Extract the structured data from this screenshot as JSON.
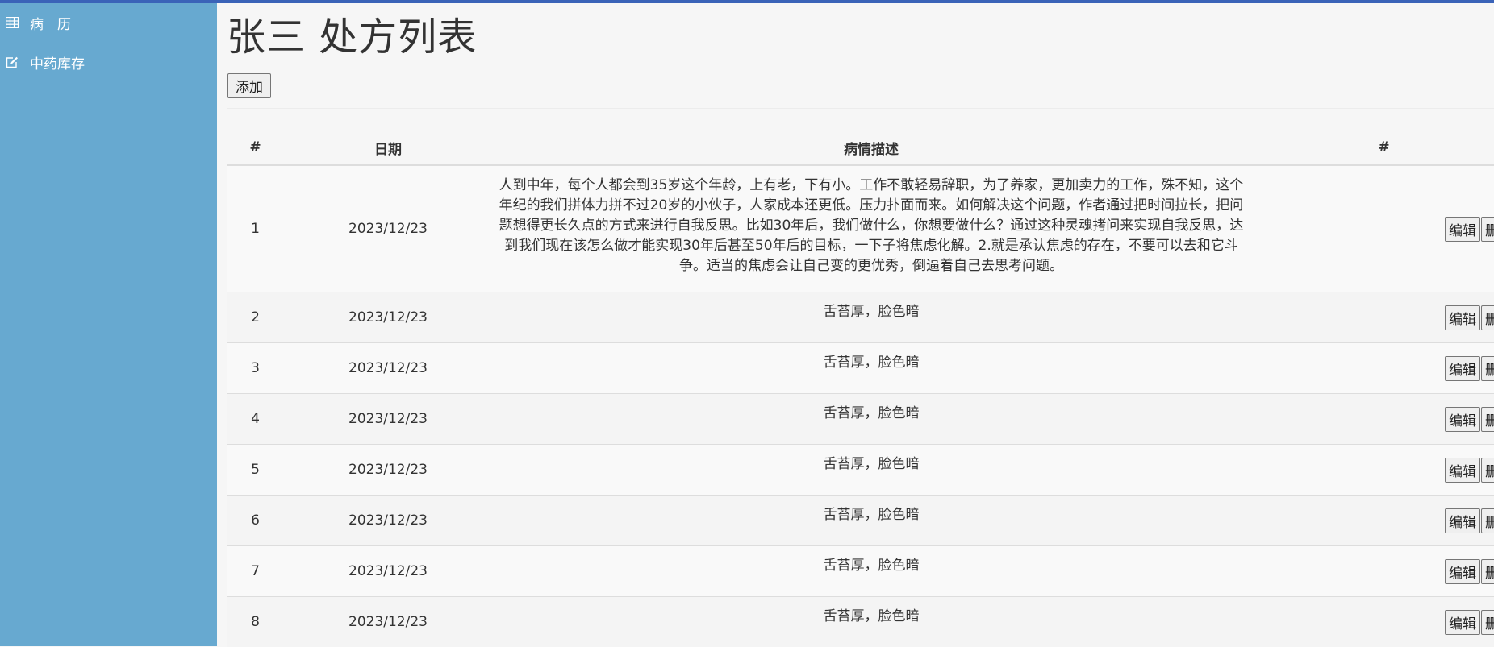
{
  "sidebar": {
    "items": [
      {
        "label": "病　历",
        "icon": "table-icon"
      },
      {
        "label": "中药库存",
        "icon": "edit-icon"
      }
    ]
  },
  "header": {
    "title": "张三 处方列表",
    "add_label": "添加"
  },
  "table": {
    "headers": [
      "#",
      "日期",
      "病情描述",
      "#"
    ],
    "edit_label": "编辑",
    "delete_label": "删除",
    "rows": [
      {
        "num": "1",
        "date": "2023/12/23",
        "desc": "人到中年，每个人都会到35岁这个年龄，上有老，下有小。工作不敢轻易辞职，为了养家，更加卖力的工作，殊不知，这个年纪的我们拼体力拼不过20岁的小伙子，人家成本还更低。压力扑面而来。如何解决这个问题，作者通过把时间拉长，把问题想得更长久点的方式来进行自我反思。比如30年后，我们做什么，你想要做什么？通过这种灵魂拷问来实现自我反思，达到我们现在该怎么做才能实现30年后甚至50年后的目标，一下子将焦虑化解。2.就是承认焦虑的存在，不要可以去和它斗争。适当的焦虑会让自己变的更优秀，倒逼着自己去思考问题。"
      },
      {
        "num": "2",
        "date": "2023/12/23",
        "desc": "舌苔厚，脸色暗"
      },
      {
        "num": "3",
        "date": "2023/12/23",
        "desc": "舌苔厚，脸色暗"
      },
      {
        "num": "4",
        "date": "2023/12/23",
        "desc": "舌苔厚，脸色暗"
      },
      {
        "num": "5",
        "date": "2023/12/23",
        "desc": "舌苔厚，脸色暗"
      },
      {
        "num": "6",
        "date": "2023/12/23",
        "desc": "舌苔厚，脸色暗"
      },
      {
        "num": "7",
        "date": "2023/12/23",
        "desc": "舌苔厚，脸色暗"
      },
      {
        "num": "8",
        "date": "2023/12/23",
        "desc": "舌苔厚，脸色暗"
      }
    ]
  },
  "colors": {
    "sidebar_bg": "#67a9d0",
    "top_bar": "#3a63b8"
  }
}
